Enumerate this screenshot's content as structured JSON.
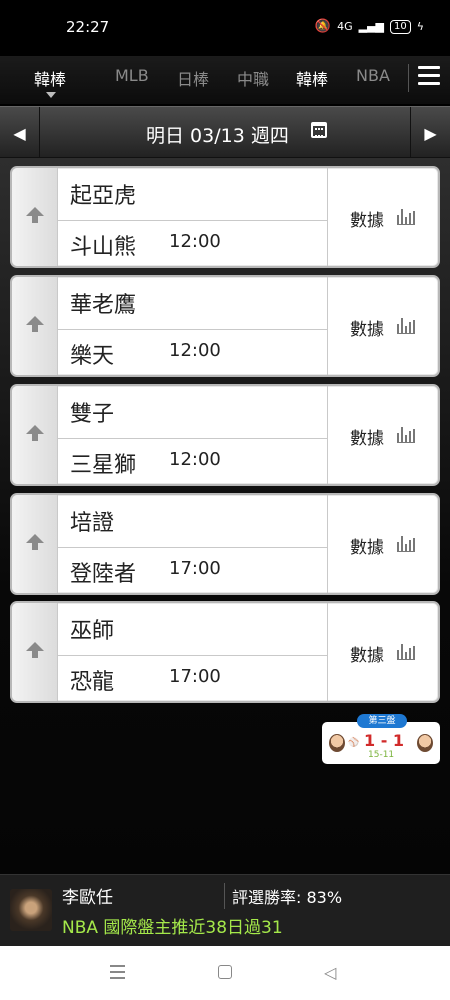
{
  "status_bar": {
    "time": "22:27",
    "network": "4G",
    "battery": "10"
  },
  "league_tabs": {
    "current": "韓棒",
    "items": [
      "MLB",
      "日棒",
      "中職",
      "韓棒",
      "NBA"
    ]
  },
  "date_bar": {
    "label": "明日 03/13 週四"
  },
  "games": [
    {
      "away": "起亞虎",
      "home": "斗山熊",
      "time": "12:00",
      "data_label": "數據"
    },
    {
      "away": "華老鷹",
      "home": "樂天",
      "time": "12:00",
      "data_label": "數據"
    },
    {
      "away": "雙子",
      "home": "三星獅",
      "time": "12:00",
      "data_label": "數據"
    },
    {
      "away": "培證",
      "home": "登陸者",
      "time": "17:00",
      "data_label": "數據"
    },
    {
      "away": "巫師",
      "home": "恐龍",
      "time": "17:00",
      "data_label": "數據"
    }
  ],
  "score_widget": {
    "badge": "第三盤",
    "score": "1 - 1",
    "sub": "15-11"
  },
  "ad": {
    "name": "李歐任",
    "win_rate": "評選勝率: 83%",
    "promo": "NBA 國際盤主推近38日過31"
  },
  "colors": {
    "accent_blue": "#1e78d2",
    "score_red": "#d12a2a",
    "promo_green": "#a4e84a"
  }
}
